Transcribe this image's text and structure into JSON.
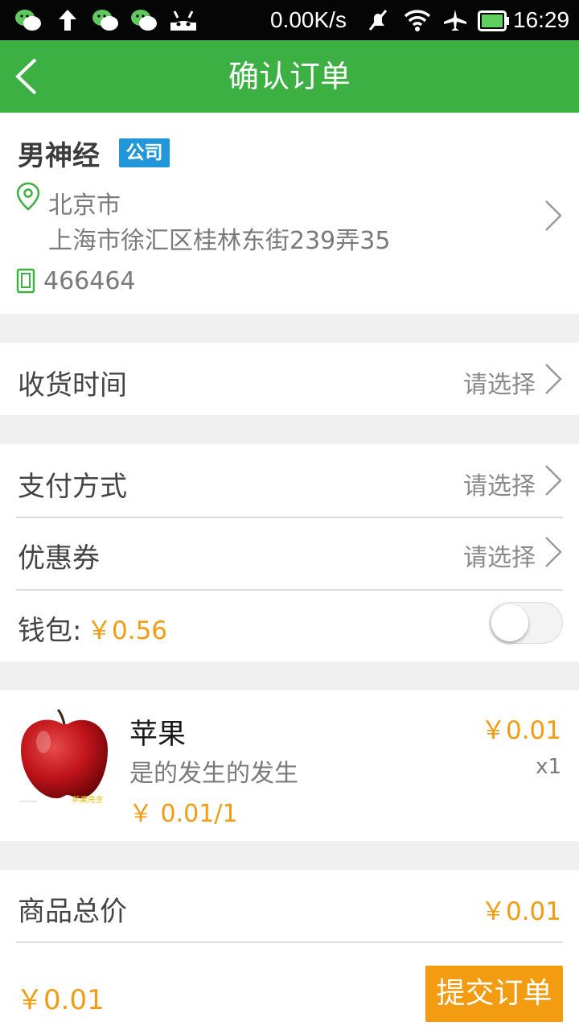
{
  "status_bar": {
    "speed": "0.00K/s",
    "time": "16:29",
    "icons": [
      "wechat-icon",
      "upload-arrow-icon",
      "wechat-icon",
      "wechat-icon",
      "android-icon",
      "mute-icon",
      "wifi-icon",
      "airplane-icon",
      "battery-icon"
    ]
  },
  "header": {
    "title": "确认订单"
  },
  "address": {
    "name": "男神经",
    "tag": "公司",
    "city": "北京市",
    "detail": "上海市徐汇区桂林东街239弄35",
    "phone": "466464"
  },
  "delivery": {
    "label": "收货时间",
    "value": "请选择"
  },
  "payment": {
    "label": "支付方式",
    "value": "请选择"
  },
  "coupon": {
    "label": "优惠券",
    "value": "请选择"
  },
  "wallet": {
    "label": "钱包:",
    "amount": "￥0.56",
    "enabled": false
  },
  "product": {
    "name": "苹果",
    "desc": "是的发生的发生",
    "unit_price": "￥ 0.01/1",
    "price": "￥0.01",
    "qty": "x1",
    "image_caption": "苹果先生"
  },
  "summary": {
    "label": "商品总价",
    "value": "￥0.01"
  },
  "footer": {
    "total": "￥0.01",
    "submit_label": "提交订单"
  },
  "colors": {
    "accent_green": "#3cb043",
    "orange": "#f39c12",
    "tag_blue": "#2196d8"
  }
}
